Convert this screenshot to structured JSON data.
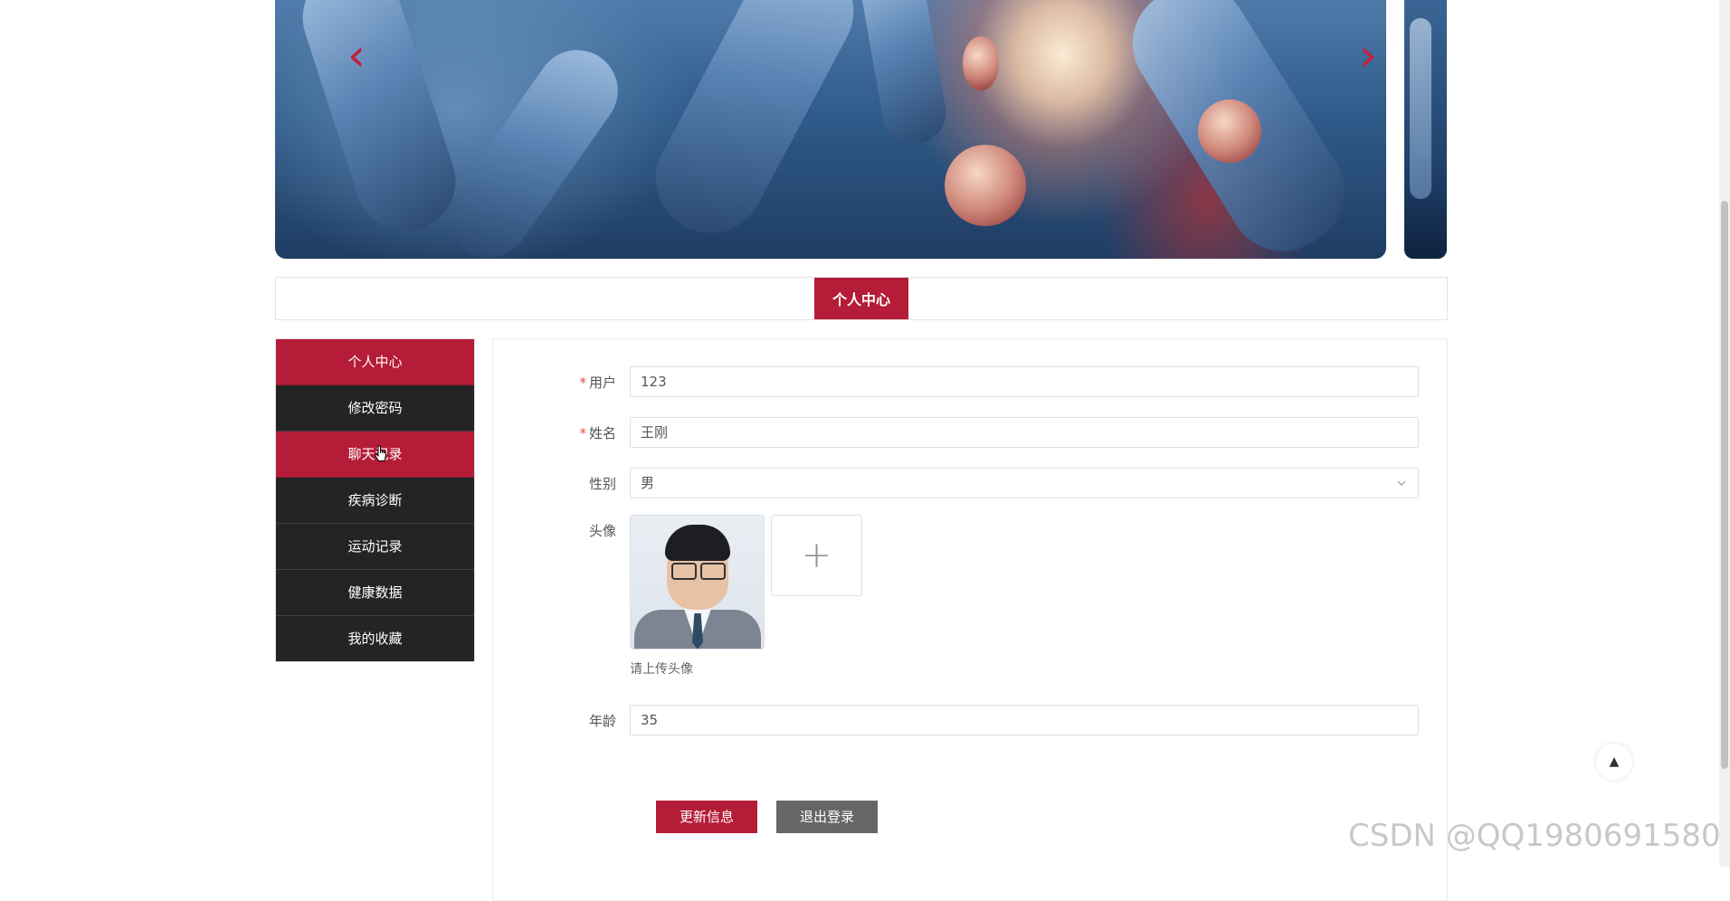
{
  "carousel": {
    "prev_icon": "chevron-left-icon",
    "next_icon": "chevron-right-icon",
    "prev_glyph": "‹",
    "next_glyph": "›",
    "accent_color": "#c51f3a"
  },
  "section": {
    "title": "个人中心"
  },
  "sidebar": {
    "items": [
      {
        "label": "个人中心",
        "active": true
      },
      {
        "label": "修改密码",
        "active": false
      },
      {
        "label": "聊天记录",
        "active": true
      },
      {
        "label": "疾病诊断",
        "active": false
      },
      {
        "label": "运动记录",
        "active": false
      },
      {
        "label": "健康数据",
        "active": false
      },
      {
        "label": "我的收藏",
        "active": false
      }
    ]
  },
  "form": {
    "user": {
      "required_mark": "*",
      "label": "用户",
      "value": "123"
    },
    "name": {
      "required_mark": "*",
      "label": "姓名",
      "value": "王刚"
    },
    "gender": {
      "label": "性别",
      "value": "男"
    },
    "avatar": {
      "label": "头像",
      "hint": "请上传头像",
      "add_glyph": "+"
    },
    "age": {
      "label": "年龄",
      "value": "35"
    }
  },
  "buttons": {
    "update": "更新信息",
    "logout": "退出登录"
  },
  "backtop_glyph": "▲",
  "watermark": "CSDN @QQ1980691580",
  "colors": {
    "primary": "#b51c37",
    "menu_dark": "#242424",
    "logout_gray": "#666666"
  }
}
